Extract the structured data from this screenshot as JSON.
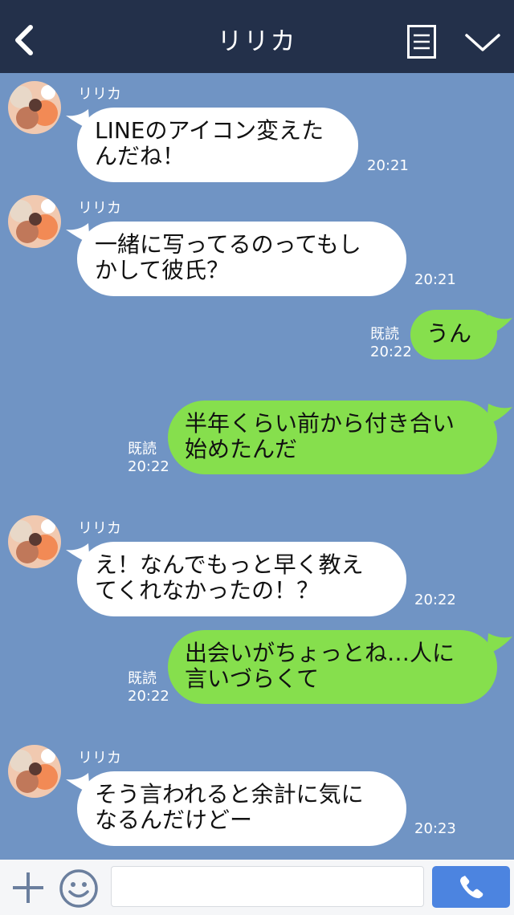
{
  "header": {
    "title": "リリカ"
  },
  "messages": [
    {
      "side": "in",
      "sender": "リリカ",
      "lines": [
        "LINEのアイコン変えた",
        "んだね！"
      ],
      "time": "20:21"
    },
    {
      "side": "in",
      "sender": "リリカ",
      "lines": [
        "一緒に写ってるのってもし",
        "かして彼氏？"
      ],
      "time": "20:21"
    },
    {
      "side": "out",
      "lines": [
        "うん"
      ],
      "read": "既読",
      "time": "20:22"
    },
    {
      "side": "out",
      "lines": [
        "半年くらい前から付き合い",
        "始めたんだ"
      ],
      "read": "既読",
      "time": "20:22"
    },
    {
      "side": "in",
      "sender": "リリカ",
      "lines": [
        "え！なんでもっと早く教え",
        "てくれなかったの！？"
      ],
      "time": "20:22"
    },
    {
      "side": "out",
      "lines": [
        "出会いがちょっとね…人に",
        "言いづらくて"
      ],
      "read": "既読",
      "time": "20:22"
    },
    {
      "side": "in",
      "sender": "リリカ",
      "lines": [
        "そう言われると余計に気に",
        "なるんだけどー"
      ],
      "time": "20:23"
    }
  ],
  "footer": {
    "input_value": ""
  },
  "colors": {
    "background": "#7094c4",
    "header": "#23304a",
    "outgoing": "#86df4d",
    "incoming": "#ffffff",
    "call_button": "#4c84e0"
  },
  "icons": [
    "back-arrow-icon",
    "menu-list-icon",
    "chevron-down-icon",
    "plus-icon",
    "emoji-icon",
    "phone-icon"
  ]
}
